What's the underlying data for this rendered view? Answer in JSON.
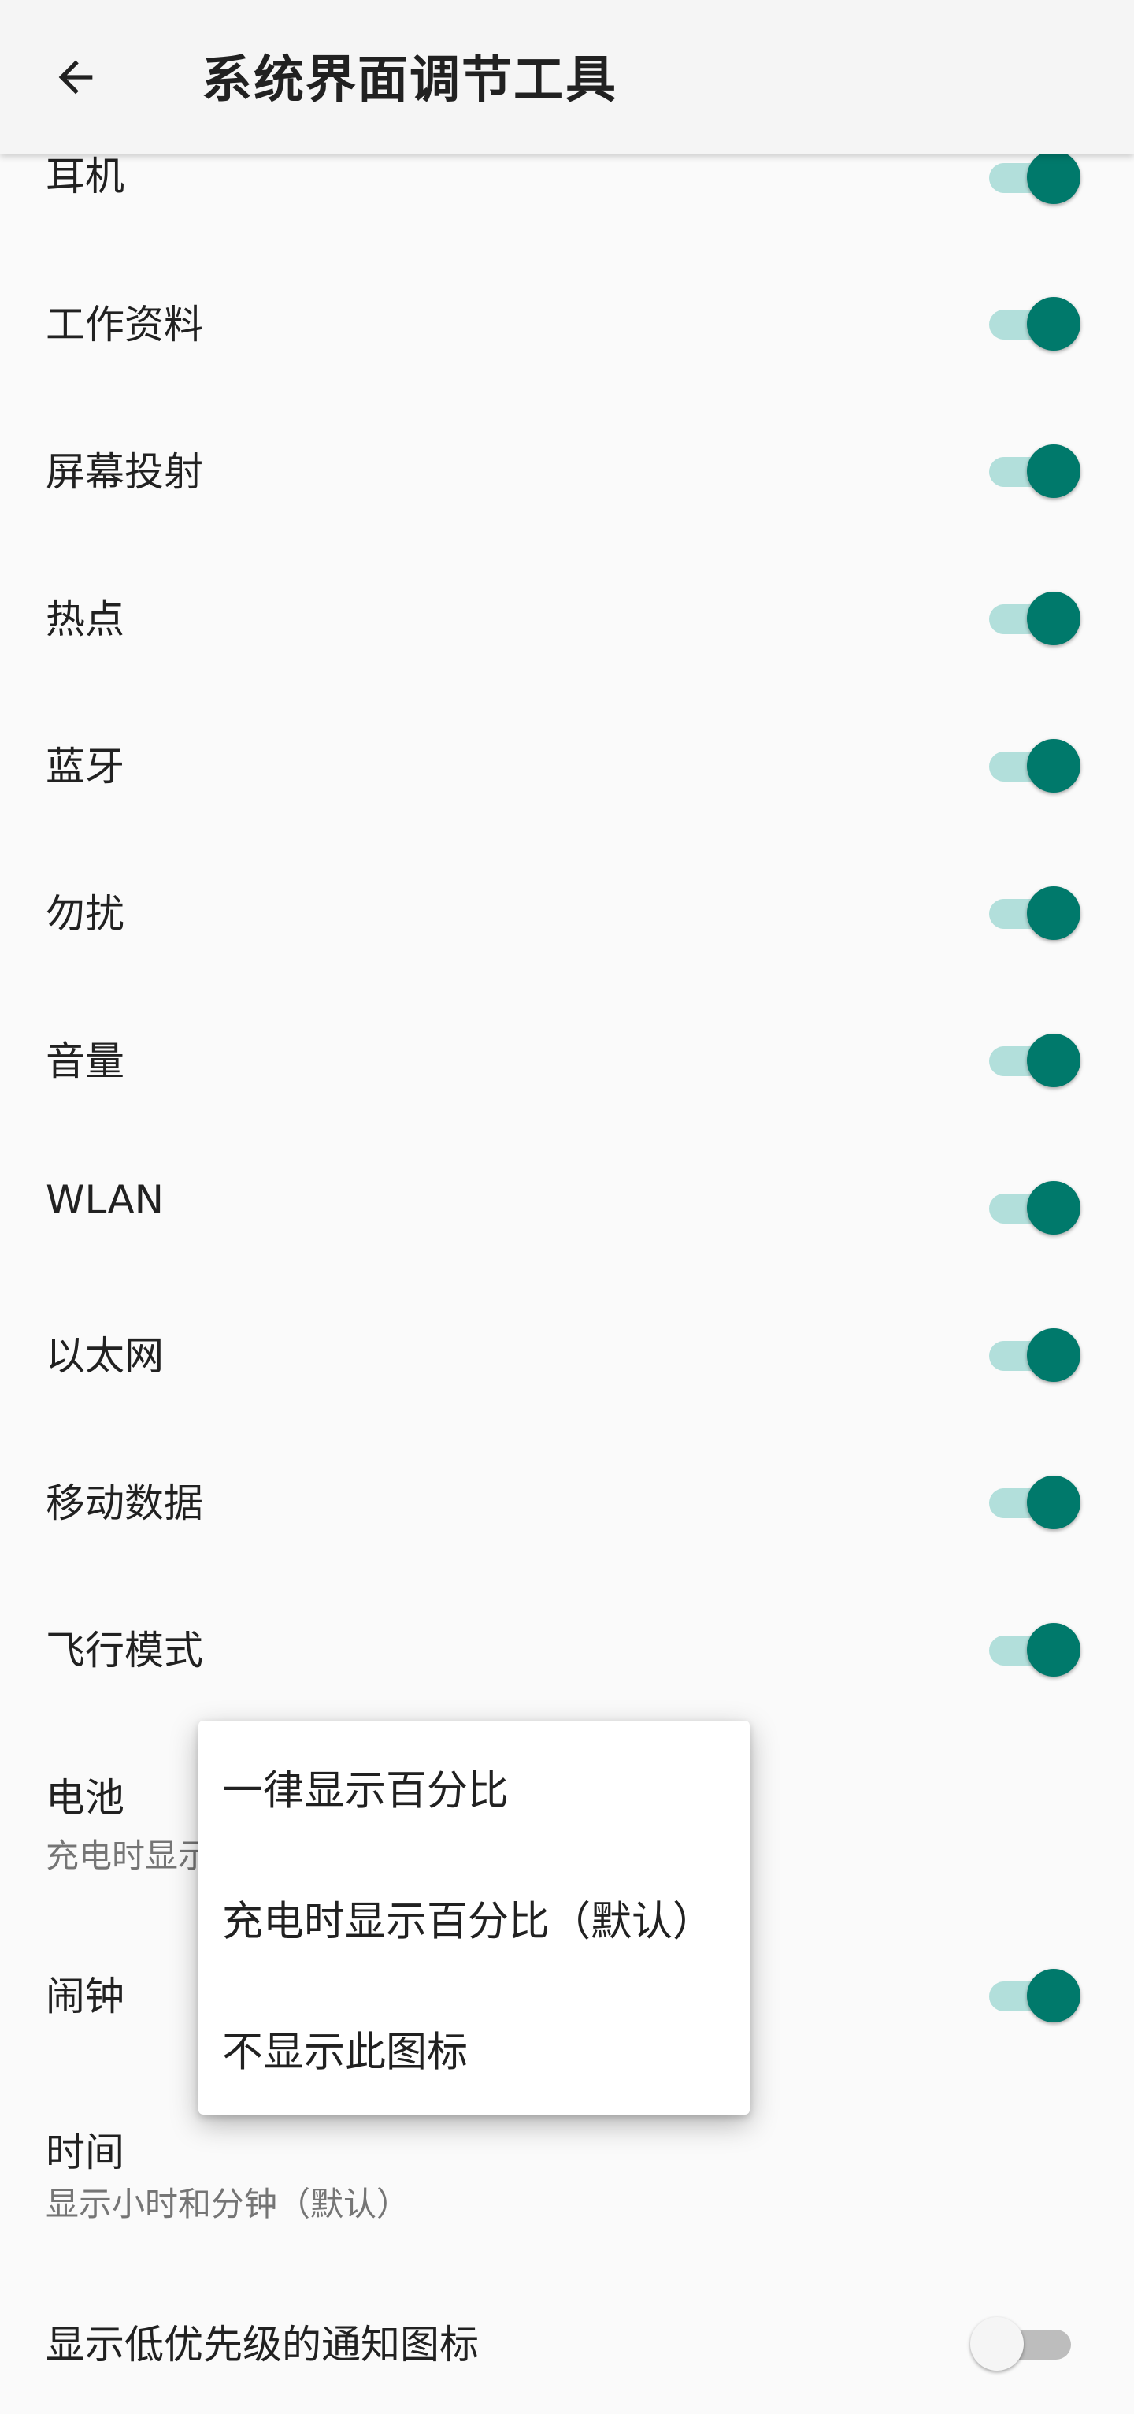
{
  "toolbar": {
    "title": "系统界面调节工具",
    "back_icon": "arrow-back-icon"
  },
  "settings": [
    {
      "label": "耳机",
      "enabled": true
    },
    {
      "label": "工作资料",
      "enabled": true
    },
    {
      "label": "屏幕投射",
      "enabled": true
    },
    {
      "label": "热点",
      "enabled": true
    },
    {
      "label": "蓝牙",
      "enabled": true
    },
    {
      "label": "勿扰",
      "enabled": true
    },
    {
      "label": "音量",
      "enabled": true
    },
    {
      "label": "WLAN",
      "enabled": true
    },
    {
      "label": "以太网",
      "enabled": true
    },
    {
      "label": "移动数据",
      "enabled": true
    },
    {
      "label": "飞行模式",
      "enabled": true
    }
  ],
  "battery": {
    "label": "电池",
    "summary": "充电时显示百分比（默认）"
  },
  "alarm": {
    "label": "闹钟",
    "enabled": true
  },
  "time": {
    "label": "时间",
    "summary": "显示小时和分钟（默认）"
  },
  "low_priority": {
    "label": "显示低优先级的通知图标",
    "enabled": false
  },
  "popup_menu": {
    "options": [
      "一律显示百分比",
      "充电时显示百分比（默认）",
      "不显示此图标"
    ]
  },
  "colors": {
    "accent": "#00796b",
    "accent_track": "#b2dfdb",
    "off_track": "#bdbdbd",
    "background": "#fafafa"
  }
}
